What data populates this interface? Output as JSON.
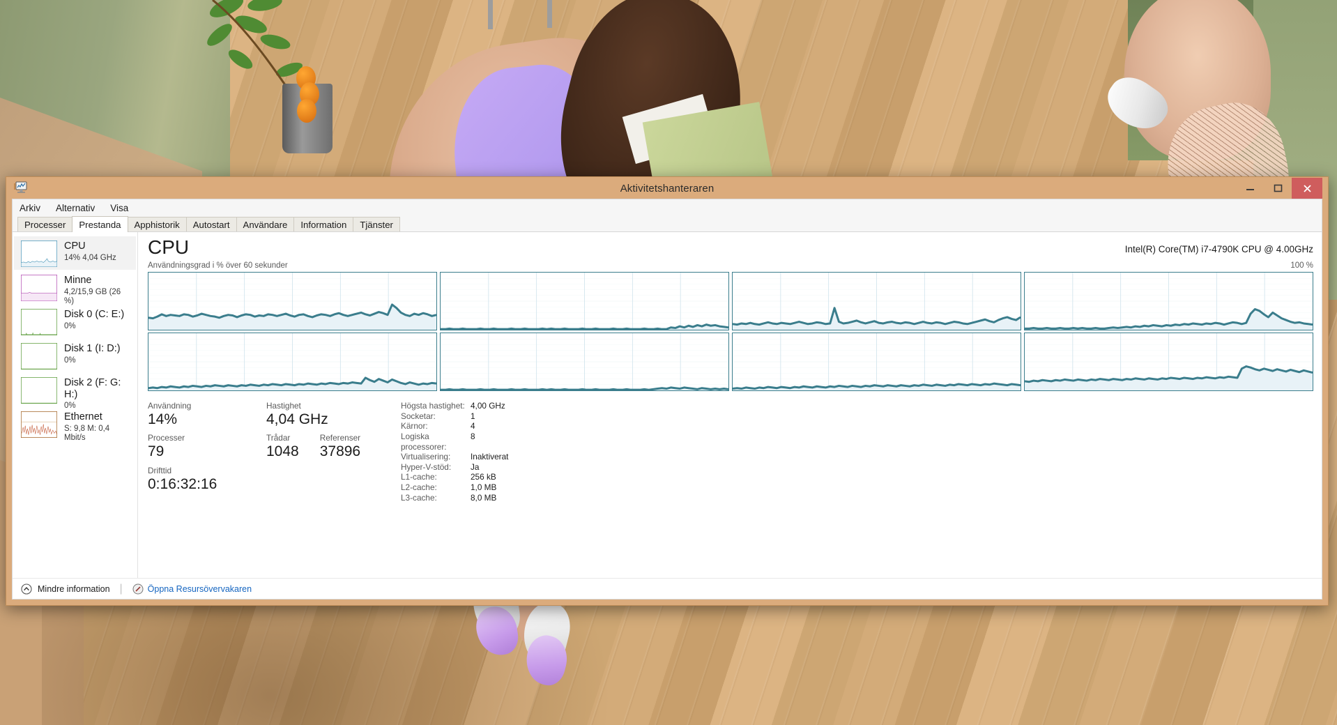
{
  "window": {
    "title": "Aktivitetshanteraren",
    "icon": "task-manager-monitor-icon",
    "controls": {
      "minimize": "–",
      "maximize": "□",
      "close": "✕"
    },
    "frame_color": "#dbab7c",
    "close_color": "#cf5d5d"
  },
  "menubar": {
    "items": [
      "Arkiv",
      "Alternativ",
      "Visa"
    ]
  },
  "tabs": {
    "active": "Prestanda",
    "items": [
      "Processer",
      "Prestanda",
      "Apphistorik",
      "Autostart",
      "Användare",
      "Information",
      "Tjänster"
    ]
  },
  "sidebar": {
    "items": [
      {
        "name": "CPU",
        "sub": "14%  4,04 GHz",
        "accent": "#4a96b8",
        "selected": true
      },
      {
        "name": "Minne",
        "sub": "4,2/15,9 GB (26 %)",
        "accent": "#b44fb4",
        "selected": false
      },
      {
        "name": "Disk 0 (C: E:)",
        "sub": "0%",
        "accent": "#5f9e3f",
        "selected": false
      },
      {
        "name": "Disk 1 (I: D:)",
        "sub": "0%",
        "accent": "#5f9e3f",
        "selected": false
      },
      {
        "name": "Disk 2 (F: G: H:)",
        "sub": "0%",
        "accent": "#5f9e3f",
        "selected": false
      },
      {
        "name": "Ethernet",
        "sub": "S: 9,8 M: 0,4 Mbit/s",
        "accent": "#a4662a",
        "selected": false
      }
    ]
  },
  "main": {
    "heading": "CPU",
    "model": "Intel(R) Core(TM) i7-4790K CPU @ 4.00GHz",
    "graph_caption": "Användningsgrad i % över 60 sekunder",
    "graph_max_label": "100 %",
    "line_color": "#3a7d8c",
    "fill_color": "#e8f2f7"
  },
  "chart_data": {
    "type": "area",
    "title": "Användningsgrad i % över 60 sekunder",
    "xlabel": "60 sekunder",
    "ylabel": "Användningsgrad i %",
    "ylim": [
      0,
      100
    ],
    "grid": true,
    "legend_position": "none",
    "panels": 8,
    "panel_layout": "4x2",
    "series": [
      {
        "name": "CPU 0",
        "values": [
          21,
          20,
          23,
          27,
          24,
          26,
          25,
          24,
          27,
          26,
          23,
          25,
          28,
          26,
          24,
          23,
          21,
          24,
          26,
          25,
          22,
          25,
          27,
          26,
          23,
          25,
          24,
          27,
          26,
          24,
          26,
          28,
          25,
          23,
          26,
          27,
          24,
          22,
          25,
          27,
          26,
          24,
          27,
          29,
          26,
          24,
          26,
          28,
          30,
          27,
          25,
          28,
          31,
          29,
          26,
          44,
          38,
          30,
          26,
          24,
          28,
          26,
          29,
          27,
          24,
          26
        ]
      },
      {
        "name": "CPU 1",
        "values": [
          1,
          1,
          2,
          1,
          1,
          2,
          1,
          1,
          1,
          2,
          1,
          1,
          2,
          1,
          1,
          1,
          2,
          1,
          1,
          2,
          1,
          1,
          1,
          2,
          1,
          2,
          1,
          1,
          2,
          1,
          1,
          1,
          2,
          1,
          1,
          2,
          1,
          1,
          1,
          2,
          1,
          1,
          2,
          1,
          1,
          1,
          2,
          1,
          1,
          2,
          1,
          1,
          4,
          3,
          6,
          4,
          7,
          5,
          8,
          6,
          9,
          7,
          8,
          6,
          5,
          4
        ]
      },
      {
        "name": "CPU 2",
        "values": [
          10,
          9,
          11,
          10,
          12,
          10,
          9,
          11,
          13,
          11,
          10,
          12,
          11,
          10,
          12,
          14,
          12,
          10,
          11,
          13,
          12,
          10,
          11,
          38,
          14,
          11,
          12,
          14,
          16,
          13,
          11,
          13,
          15,
          12,
          11,
          13,
          14,
          12,
          11,
          13,
          12,
          10,
          12,
          14,
          12,
          11,
          13,
          12,
          10,
          12,
          14,
          13,
          11,
          10,
          12,
          14,
          16,
          18,
          15,
          13,
          17,
          20,
          22,
          19,
          17,
          22
        ]
      },
      {
        "name": "CPU 3",
        "values": [
          2,
          2,
          3,
          2,
          2,
          3,
          2,
          2,
          3,
          2,
          2,
          3,
          2,
          3,
          2,
          2,
          3,
          2,
          2,
          3,
          4,
          3,
          4,
          5,
          4,
          6,
          5,
          7,
          6,
          8,
          7,
          6,
          8,
          7,
          9,
          8,
          10,
          9,
          11,
          10,
          9,
          11,
          10,
          12,
          11,
          9,
          11,
          13,
          12,
          10,
          12,
          28,
          36,
          33,
          27,
          22,
          30,
          25,
          20,
          17,
          14,
          12,
          13,
          11,
          10,
          9
        ]
      },
      {
        "name": "CPU 4",
        "values": [
          4,
          5,
          4,
          6,
          5,
          7,
          6,
          5,
          7,
          6,
          8,
          7,
          6,
          8,
          7,
          9,
          8,
          7,
          9,
          8,
          7,
          9,
          8,
          10,
          9,
          8,
          10,
          9,
          11,
          10,
          9,
          11,
          10,
          9,
          11,
          10,
          12,
          11,
          10,
          12,
          11,
          13,
          12,
          11,
          13,
          12,
          14,
          13,
          12,
          22,
          18,
          15,
          20,
          17,
          14,
          19,
          16,
          13,
          11,
          14,
          12,
          10,
          12,
          11,
          13,
          12
        ]
      },
      {
        "name": "CPU 5",
        "values": [
          1,
          1,
          2,
          1,
          1,
          2,
          1,
          1,
          1,
          2,
          1,
          1,
          2,
          1,
          1,
          1,
          2,
          1,
          1,
          2,
          1,
          1,
          1,
          2,
          1,
          2,
          1,
          1,
          2,
          1,
          1,
          1,
          2,
          1,
          1,
          2,
          1,
          1,
          1,
          2,
          1,
          1,
          2,
          1,
          1,
          1,
          2,
          1,
          2,
          3,
          4,
          3,
          5,
          4,
          3,
          5,
          4,
          3,
          2,
          4,
          3,
          2,
          3,
          2,
          3,
          2
        ]
      },
      {
        "name": "CPU 6",
        "values": [
          3,
          4,
          3,
          5,
          4,
          3,
          5,
          4,
          6,
          5,
          4,
          6,
          5,
          4,
          6,
          5,
          7,
          6,
          5,
          7,
          6,
          5,
          7,
          6,
          8,
          7,
          6,
          8,
          7,
          6,
          8,
          7,
          9,
          8,
          7,
          9,
          8,
          7,
          9,
          8,
          7,
          9,
          8,
          10,
          9,
          8,
          10,
          9,
          8,
          10,
          9,
          11,
          10,
          9,
          11,
          10,
          9,
          11,
          10,
          12,
          11,
          10,
          9,
          11,
          10,
          9
        ]
      },
      {
        "name": "CPU 7",
        "values": [
          16,
          15,
          17,
          16,
          18,
          17,
          16,
          18,
          17,
          19,
          18,
          17,
          19,
          18,
          17,
          19,
          18,
          20,
          19,
          18,
          20,
          19,
          18,
          20,
          19,
          21,
          20,
          19,
          21,
          20,
          19,
          21,
          20,
          22,
          21,
          20,
          22,
          21,
          20,
          22,
          21,
          23,
          22,
          21,
          23,
          22,
          24,
          23,
          22,
          38,
          42,
          40,
          37,
          35,
          38,
          36,
          34,
          37,
          35,
          33,
          36,
          34,
          32,
          35,
          33,
          31
        ]
      }
    ]
  },
  "stats": {
    "left": [
      {
        "label": "Användning",
        "value": "14%"
      },
      {
        "label": "Processer",
        "value": "79"
      },
      {
        "label": "Drifttid",
        "value": "0:16:32:16"
      }
    ],
    "mid": [
      {
        "label": "Hastighet",
        "value": "4,04 GHz"
      },
      {
        "label": "Trådar",
        "value": "1048"
      }
    ],
    "third": [
      {
        "label": "Referenser",
        "value": "37896"
      }
    ],
    "details": [
      {
        "key": "Högsta hastighet:",
        "value": "4,00 GHz"
      },
      {
        "key": "Socketar:",
        "value": "1"
      },
      {
        "key": "Kärnor:",
        "value": "4"
      },
      {
        "key": "Logiska processorer:",
        "value": "8"
      },
      {
        "key": "Virtualisering:",
        "value": "Inaktiverat"
      },
      {
        "key": "Hyper-V-stöd:",
        "value": "Ja"
      },
      {
        "key": "L1-cache:",
        "value": "256 kB"
      },
      {
        "key": "L2-cache:",
        "value": "1,0 MB"
      },
      {
        "key": "L3-cache:",
        "value": "8,0 MB"
      }
    ]
  },
  "footer": {
    "fewer_details": "Mindre information",
    "fewer_icon": "chevron-up-circle-icon",
    "resource_monitor": "Öppna Resursövervakaren",
    "resource_icon": "resource-monitor-icon",
    "link_color": "#1565c0"
  }
}
